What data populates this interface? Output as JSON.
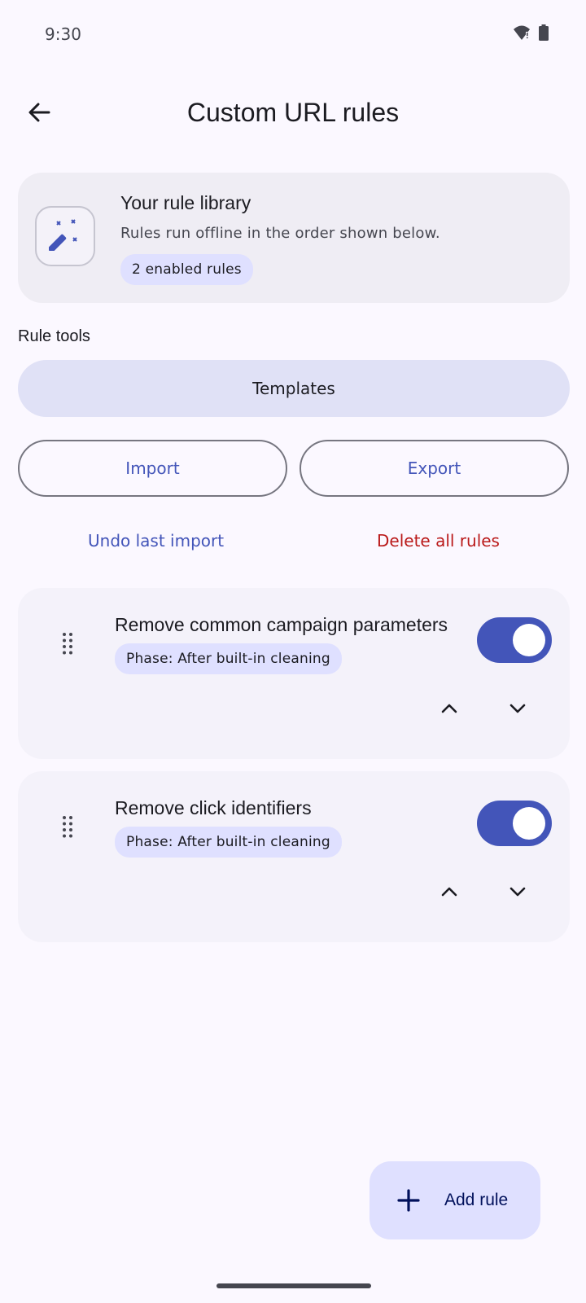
{
  "status_bar": {
    "time": "9:30",
    "icons": [
      "wifi-alert-icon",
      "battery-icon"
    ]
  },
  "top_bar": {
    "title": "Custom URL rules",
    "back_icon": "arrow-back-icon"
  },
  "library_card": {
    "icon": "magic-wand-icon",
    "title": "Your rule library",
    "subtitle": "Rules run offline in the order shown below.",
    "chip": "2 enabled rules"
  },
  "tools": {
    "label": "Rule tools",
    "templates": "Templates",
    "import": "Import",
    "export": "Export",
    "undo": "Undo last import",
    "delete_all": "Delete all rules"
  },
  "rules": [
    {
      "title": "Remove common campaign parameters",
      "phase": "Phase: After built-in cleaning",
      "enabled": true
    },
    {
      "title": "Remove click identifiers",
      "phase": "Phase: After built-in cleaning",
      "enabled": true
    }
  ],
  "fab": {
    "label": "Add rule",
    "icon": "plus-icon"
  },
  "colors": {
    "accent": "#4355b9",
    "danger": "#ba1a1a",
    "chip": "#dfe0ff",
    "background": "#fbf8ff"
  }
}
